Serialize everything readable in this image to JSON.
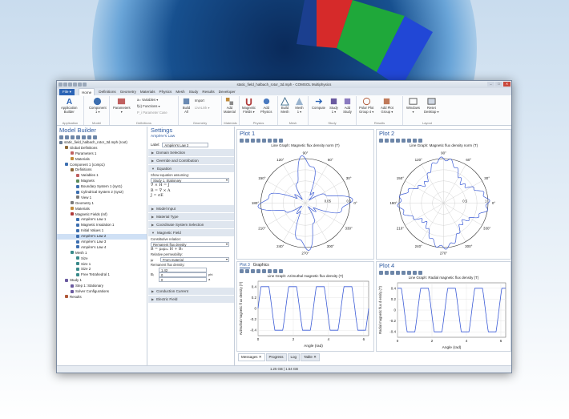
{
  "window": {
    "title": "static_field_halbach_rotor_3d.mph - COMSOL Multiphysics"
  },
  "menu_tabs": [
    "File ▾",
    "Home",
    "Definitions",
    "Geometry",
    "Materials",
    "Physics",
    "Mesh",
    "Study",
    "Results",
    "Developer"
  ],
  "ribbon": {
    "groups": [
      "Application",
      "Model",
      "Definitions",
      "Geometry",
      "Materials",
      "Physics",
      "Mesh",
      "Study",
      "Results",
      "Layout"
    ],
    "app_builder": "Application\nBuilder",
    "component": "Component\n1 ▾",
    "parameters": "Parameters\n▾",
    "variables": "a= Variables ▾",
    "functions": "f(x) Functions ▾",
    "param_case": "P_i Parameter Case",
    "build_all": "Build\nAll",
    "import": "Import",
    "livelink": "LiveLink ▾",
    "add_material": "Add\nMaterial",
    "magnetic_fields": "Magnetic\nFields ▾",
    "add_physics": "Add\nPhysics",
    "build_mesh": "Build\nMesh",
    "mesh1": "Mesh\n1 ▾",
    "compute": "Compute",
    "study1": "Study\n1 ▾",
    "add_study": "Add\nStudy",
    "polar_plot": "Polar Plot\nGroup 4 ▾",
    "add_plot": "Add Plot\nGroup ▾",
    "windows": "Windows\n▾",
    "reset_desktop": "Reset\nDesktop ▾"
  },
  "model_builder": {
    "title": "Model Builder",
    "items": [
      {
        "label": "static_field_halbach_rotor_3d.mph (root)",
        "depth": 0,
        "color": "#6a7d95"
      },
      {
        "label": "Global Definitions",
        "depth": 1,
        "color": "#8d6a3a"
      },
      {
        "label": "Parameters 1",
        "depth": 2,
        "color": "#c06060"
      },
      {
        "label": "Materials",
        "depth": 2,
        "color": "#c08a3a"
      },
      {
        "label": "Component 1 (comp1)",
        "depth": 1,
        "color": "#3d6fb0"
      },
      {
        "label": "Definitions",
        "depth": 2,
        "color": "#8d6a3a"
      },
      {
        "label": "Variables 1",
        "depth": 3,
        "color": "#c06060"
      },
      {
        "label": "Magnets",
        "depth": 3,
        "color": "#5a8a5a"
      },
      {
        "label": "Boundary System 1 (sys1)",
        "depth": 3,
        "color": "#3d6fb0"
      },
      {
        "label": "Cylindrical System 2 (sys2)",
        "depth": 3,
        "color": "#3d6fb0"
      },
      {
        "label": "View 1",
        "depth": 3,
        "color": "#7a7a7a"
      },
      {
        "label": "Geometry 1",
        "depth": 2,
        "color": "#7a7a7a"
      },
      {
        "label": "Materials",
        "depth": 2,
        "color": "#c08a3a"
      },
      {
        "label": "Magnetic Fields (mf)",
        "depth": 2,
        "color": "#b03a3a"
      },
      {
        "label": "Ampère's Law 1",
        "depth": 3,
        "color": "#3d6fb0"
      },
      {
        "label": "Magnetic Insulation 1",
        "depth": 3,
        "color": "#3d6fb0"
      },
      {
        "label": "Initial Values 1",
        "depth": 3,
        "color": "#3d6fb0"
      },
      {
        "label": "Ampère's Law 2",
        "depth": 3,
        "color": "#3d6fb0",
        "selected": true
      },
      {
        "label": "Ampère's Law 3",
        "depth": 3,
        "color": "#3d6fb0"
      },
      {
        "label": "Ampère's Law 4",
        "depth": 3,
        "color": "#3d6fb0"
      },
      {
        "label": "Mesh 1",
        "depth": 2,
        "color": "#3a8a8a"
      },
      {
        "label": "Size",
        "depth": 3,
        "color": "#3a8a8a"
      },
      {
        "label": "Size 1",
        "depth": 3,
        "color": "#3a8a8a"
      },
      {
        "label": "Size 2",
        "depth": 3,
        "color": "#3a8a8a"
      },
      {
        "label": "Free Tetrahedral 1",
        "depth": 3,
        "color": "#3a8a8a"
      },
      {
        "label": "Study 1",
        "depth": 1,
        "color": "#6a5aa0"
      },
      {
        "label": "Step 1: Stationary",
        "depth": 2,
        "color": "#6a5aa0"
      },
      {
        "label": "Solver Configurations",
        "depth": 2,
        "color": "#6a5aa0"
      },
      {
        "label": "Results",
        "depth": 1,
        "color": "#b05a3a"
      }
    ]
  },
  "settings": {
    "title": "Settings",
    "subtitle": "Ampère's Law",
    "label_caption": "Label:",
    "label_value": "Ampère's Law 2",
    "sections": {
      "domain_selection": "Domain Selection",
      "override": "Override and Contribution",
      "equation": "Equation",
      "model_input": "Model Input",
      "material_type": "Material Type",
      "coord_system": "Coordinate System Selection",
      "magnetic_field": "Magnetic Field",
      "conduction_current": "Conduction Current",
      "electric_field": "Electric Field"
    },
    "show_eq_label": "Show equation assuming:",
    "show_eq_value": "Study 1, Stationary",
    "eq1": "∇ × H = J",
    "eq2": "B = ∇ × A",
    "eq3": "J = σE",
    "constitutive_label": "Constitutive relation:",
    "constitutive_value": "Remanent flux density",
    "eq4": "B = μ₀μᵣₑ H + Bᵣ",
    "rel_perm_label": "Relative permeability:",
    "rel_perm_symbol": "μᵣ",
    "rel_perm_value": "From material",
    "remanent_label": "Remanent flux density:",
    "br_symbol": "Bᵣ",
    "br_values": [
      "1.42",
      "0",
      "0"
    ],
    "br_units": [
      "",
      "phi",
      "a"
    ]
  },
  "plots": [
    {
      "tab": "Plot 1",
      "title": "Line Graph: Magnetic flux density norm (T)",
      "type": "polar",
      "angles": [
        "0°",
        "30°",
        "60°",
        "90°",
        "120°",
        "150°",
        "180°",
        "210°",
        "240°",
        "270°",
        "300°",
        "330°"
      ],
      "radial": [
        "0.05",
        "0.1"
      ],
      "chart_data": {
        "type": "line",
        "polar": true,
        "xlabel": "",
        "ylabel": "",
        "theta_period_deg": 90,
        "r_min": 0.02,
        "r_max": 0.1
      }
    },
    {
      "tab": "Plot 2",
      "title": "Line Graph: Magnetic flux density norm (T)",
      "type": "polar",
      "angles": [
        "0°",
        "30°",
        "60°",
        "90°",
        "120°",
        "150°",
        "180°",
        "210°",
        "240°",
        "270°",
        "300°",
        "330°"
      ],
      "radial": [
        "0.5",
        "1"
      ],
      "chart_data": {
        "type": "line",
        "polar": true,
        "xlabel": "",
        "ylabel": "",
        "theta_period_deg": 90,
        "r_min": 0.45,
        "r_max": 0.9
      }
    },
    {
      "tab": "Plot 3",
      "tab2": "Graphics",
      "title": "Line Graph: Azimuthal magnetic flux density (T)",
      "type": "cart",
      "xlabel": "Angle (rad)",
      "ylabel": "Azimuthal magnetic fl ux density (T)",
      "xticks": [
        "0",
        "2",
        "4",
        "6"
      ],
      "yticks": [
        "0.4",
        "0.2",
        "0",
        "-0.2",
        "-0.4"
      ],
      "chart_data": {
        "type": "line",
        "xlim": [
          0,
          6.28
        ],
        "ylim": [
          -0.5,
          0.5
        ],
        "amplitude": 0.4,
        "cycles": 4
      }
    },
    {
      "tab": "Plot 4",
      "title": "Line Graph: Radial magnetic flux density (T)",
      "type": "cart",
      "xlabel": "Angle (rad)",
      "ylabel": "Radial magnetic flux d ensity (T)",
      "xticks": [
        "0",
        "2",
        "4",
        "6"
      ],
      "yticks": [
        "0.4",
        "0.2",
        "0",
        "-0.2",
        "-0.4"
      ],
      "chart_data": {
        "type": "line",
        "xlim": [
          0,
          6.28
        ],
        "ylim": [
          -0.5,
          0.5
        ],
        "amplitude": 0.4,
        "cycles": 4
      }
    }
  ],
  "bottom_tabs": [
    "Messages ✕",
    "Progress",
    "Log",
    "Table ✕"
  ],
  "status": "1.25 GB | 1.54 GB",
  "colors": {
    "accent": "#2a63b5",
    "plot_line": "#3b5bd6"
  }
}
